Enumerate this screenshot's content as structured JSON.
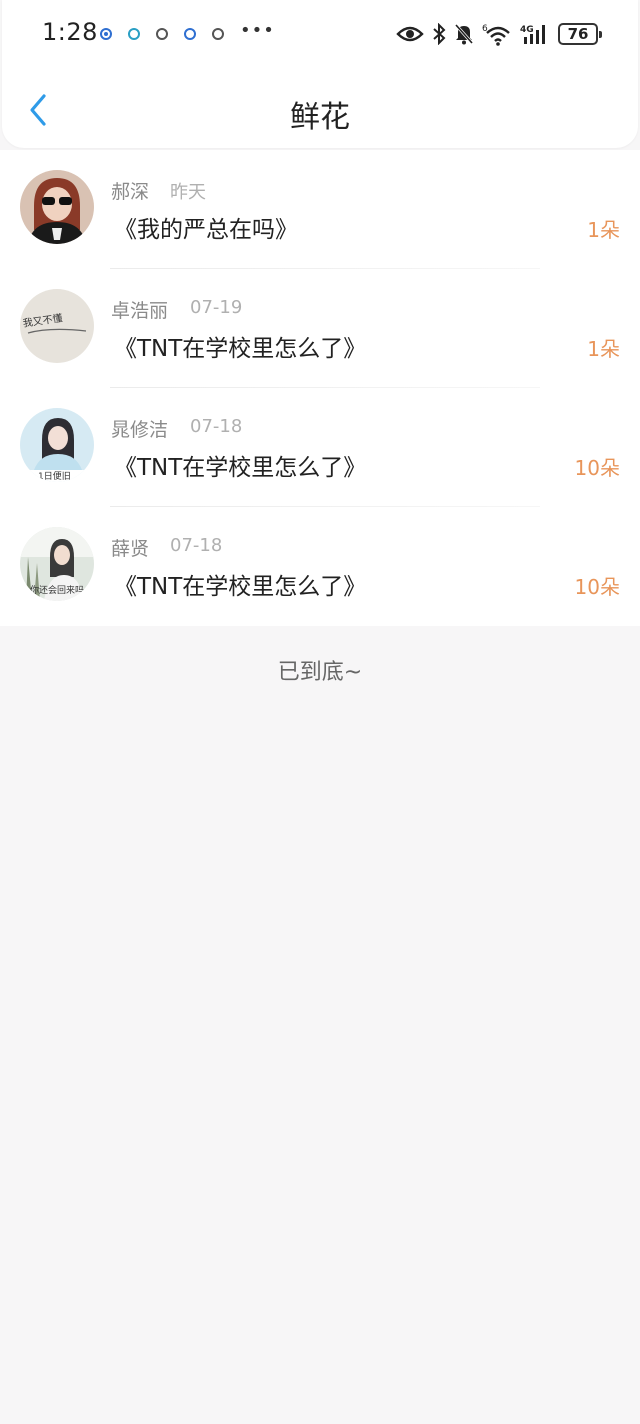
{
  "status_bar": {
    "time": "1:28",
    "more": "•••",
    "battery": "76",
    "network": "4G",
    "wifi_badge": "6"
  },
  "nav": {
    "title": "鲜花"
  },
  "list": [
    {
      "name": "郝深",
      "date": "昨天",
      "post": "《我的严总在吗》",
      "count": "1朵",
      "avatar_text": ""
    },
    {
      "name": "卓浩丽",
      "date": "07-19",
      "post": "《TNT在学校里怎么了》",
      "count": "1朵",
      "avatar_text": "我又不懂"
    },
    {
      "name": "晁修洁",
      "date": "07-18",
      "post": "《TNT在学校里怎么了》",
      "count": "10朵",
      "avatar_text": "1日便旧"
    },
    {
      "name": "薛贤",
      "date": "07-18",
      "post": "《TNT在学校里怎么了》",
      "count": "10朵",
      "avatar_text": "你还会回来吗"
    }
  ],
  "footer": {
    "end_text": "已到底~"
  },
  "colors": {
    "accent_blue": "#2f9be8",
    "count_orange": "#e8955a",
    "background": "#f7f6f7"
  }
}
